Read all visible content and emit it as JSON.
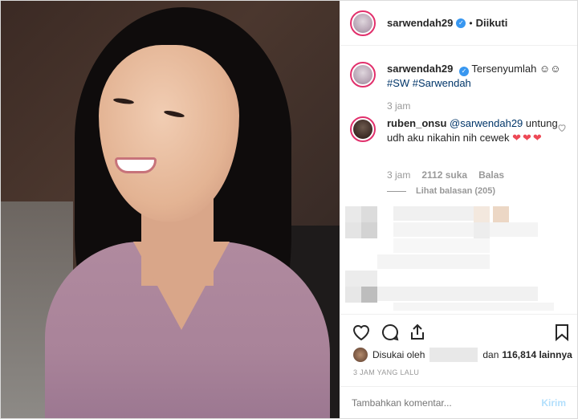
{
  "post": {
    "author": "sarwendah29",
    "follow_status": "Diikuti",
    "caption_text": "Tersenyumlah ☺☺",
    "caption_tags": "#SW #Sarwendah",
    "caption_time": "3 jam"
  },
  "comment": {
    "author": "ruben_onsu",
    "mention": "@sarwendah29",
    "text": "untung udh aku nikahin nih cewek",
    "hearts": "❤❤❤",
    "time": "3 jam",
    "likes": "2112 suka",
    "reply_label": "Balas",
    "view_replies": "Lihat balasan (205)"
  },
  "likes": {
    "prefix": "Disukai oleh",
    "middle": "dan",
    "count_text": "116,814 lainnya"
  },
  "timestamp": "3 JAM YANG LALU",
  "composer": {
    "placeholder": "Tambahkan komentar...",
    "send_label": "Kirim"
  },
  "icons": {
    "verified": "verified-badge-icon",
    "heart": "heart-icon",
    "comment": "comment-icon",
    "share": "share-icon",
    "bookmark": "bookmark-icon"
  },
  "colors": {
    "link": "#003569",
    "verified": "#3897f0",
    "heart_red": "#ed4956",
    "send_disabled": "#b2dffc",
    "muted": "#999999"
  }
}
